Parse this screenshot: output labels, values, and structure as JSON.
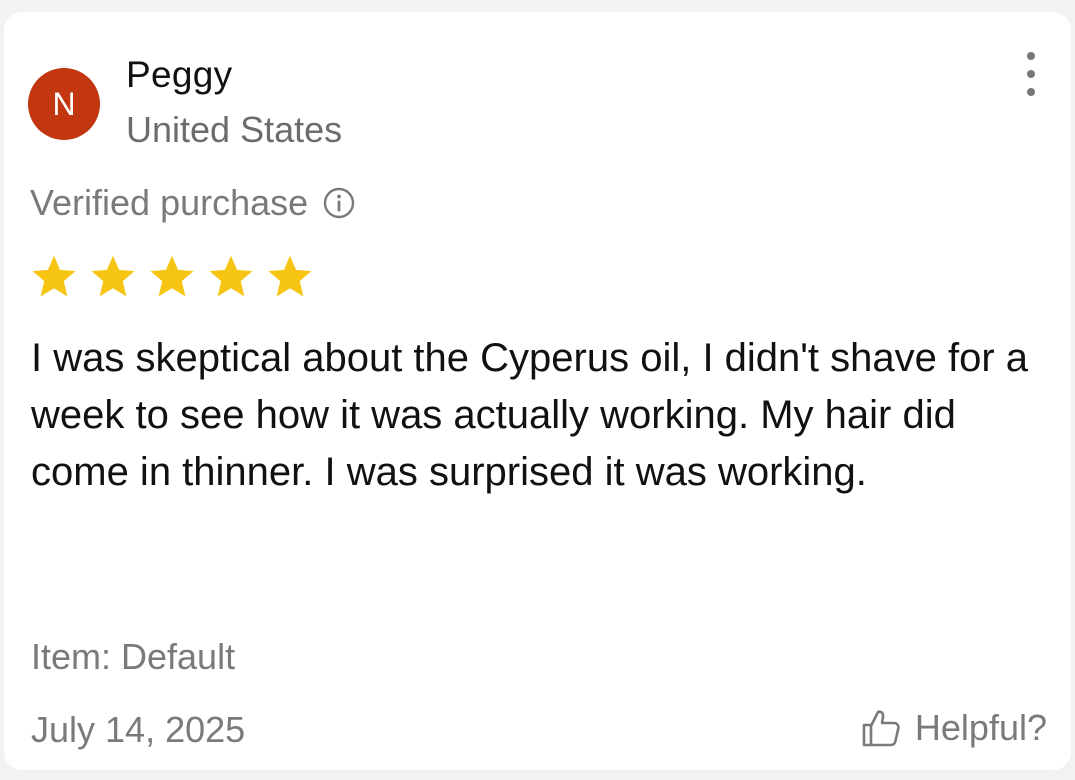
{
  "reviewer": {
    "initial": "N",
    "name": "Peggy",
    "country": "United States",
    "avatar_color": "#c2370f"
  },
  "verified_label": "Verified purchase",
  "rating": {
    "value": 5,
    "max": 5,
    "star_color": "#f6c513"
  },
  "review_text": "I was skeptical about the Cyperus oil, I didn't shave for a week to see how it was actually working. My hair did come in thinner. I was surprised it was working.",
  "item_label": "Item: Default",
  "date": "July 14, 2025",
  "helpful_label": "Helpful?",
  "icons": {
    "menu": "more-vertical-icon",
    "info": "info-icon",
    "star": "star-icon",
    "helpful": "thumbs-up-icon"
  }
}
